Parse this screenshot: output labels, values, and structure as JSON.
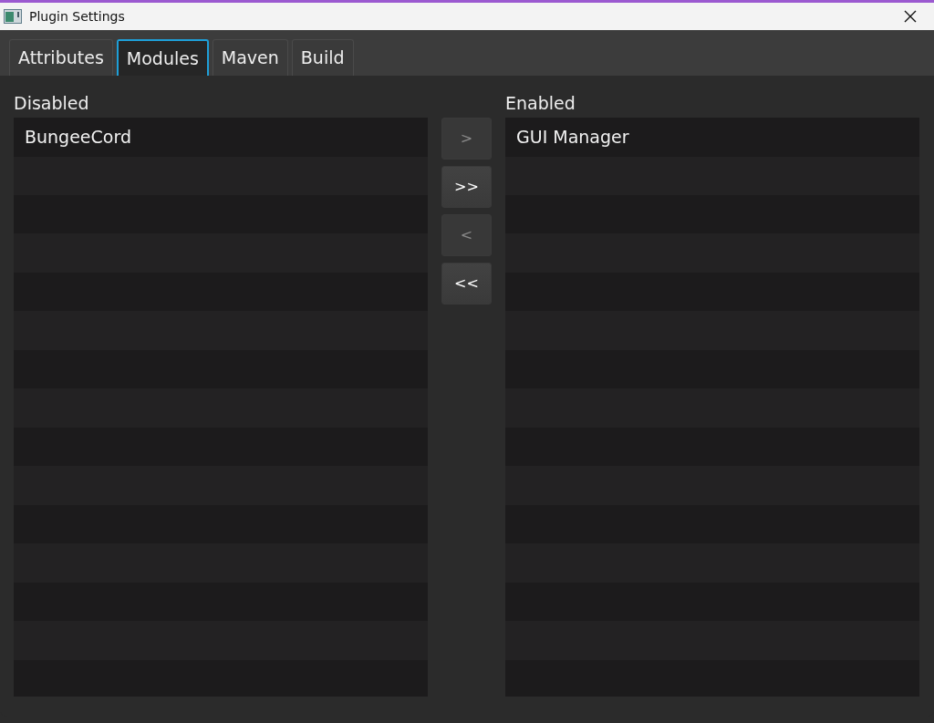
{
  "window": {
    "title": "Plugin Settings"
  },
  "tabs": [
    {
      "label": "Attributes",
      "selected": false
    },
    {
      "label": "Modules",
      "selected": true
    },
    {
      "label": "Maven",
      "selected": false
    },
    {
      "label": "Build",
      "selected": false
    }
  ],
  "disabled_list": {
    "label": "Disabled",
    "items": [
      {
        "label": "BungeeCord",
        "selected": false
      }
    ]
  },
  "move_buttons": [
    {
      "label": ">",
      "disabled": true
    },
    {
      "label": ">>",
      "disabled": false
    },
    {
      "label": "<",
      "disabled": true
    },
    {
      "label": "<<",
      "disabled": false
    }
  ],
  "enabled_list": {
    "label": "Enabled",
    "items": [
      {
        "label": "GUI Manager",
        "selected": false
      }
    ]
  }
}
